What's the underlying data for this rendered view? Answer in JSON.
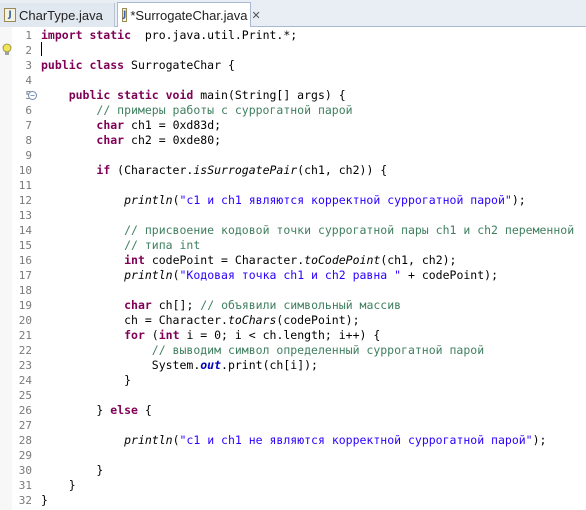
{
  "tabs": [
    {
      "label": "CharType.java",
      "active": false
    },
    {
      "label": "*SurrogateChar.java",
      "active": true
    }
  ],
  "lines": [
    {
      "n": "1",
      "t": [
        [
          "kw",
          "import static"
        ],
        [
          "",
          "  pro.java.util.Print.*;"
        ]
      ]
    },
    {
      "n": "2",
      "t": []
    },
    {
      "n": "3",
      "t": [
        [
          "kw",
          "public class"
        ],
        [
          "",
          " SurrogateChar {"
        ]
      ]
    },
    {
      "n": "4",
      "t": []
    },
    {
      "n": "5",
      "t": [
        [
          "",
          "    "
        ],
        [
          "kw",
          "public static void"
        ],
        [
          "",
          " main(String[] args) {"
        ]
      ]
    },
    {
      "n": "6",
      "t": [
        [
          "",
          "        "
        ],
        [
          "cm",
          "// примеры работы с суррогатной парой"
        ]
      ]
    },
    {
      "n": "7",
      "t": [
        [
          "",
          "        "
        ],
        [
          "kw",
          "char"
        ],
        [
          "",
          " "
        ],
        [
          "vr",
          "ch1"
        ],
        [
          "",
          " = 0xd83d;"
        ]
      ]
    },
    {
      "n": "8",
      "t": [
        [
          "",
          "        "
        ],
        [
          "kw",
          "char"
        ],
        [
          "",
          " "
        ],
        [
          "vr",
          "ch2"
        ],
        [
          "",
          " = 0xde80;"
        ]
      ]
    },
    {
      "n": "9",
      "t": []
    },
    {
      "n": "10",
      "t": [
        [
          "",
          "        "
        ],
        [
          "kw",
          "if"
        ],
        [
          "",
          " (Character."
        ],
        [
          "it",
          "isSurrogatePair"
        ],
        [
          "",
          "(ch1, ch2)) {"
        ]
      ]
    },
    {
      "n": "11",
      "t": []
    },
    {
      "n": "12",
      "t": [
        [
          "",
          "            "
        ],
        [
          "it",
          "println"
        ],
        [
          "",
          "("
        ],
        [
          "st",
          "\"c1 и ch1 являются корректной суррогатной парой\""
        ],
        [
          "",
          ");"
        ]
      ]
    },
    {
      "n": "13",
      "t": []
    },
    {
      "n": "14",
      "t": [
        [
          "",
          "            "
        ],
        [
          "cm",
          "// присвоение кодовой точки суррогатной пары ch1 и ch2 переменной"
        ]
      ]
    },
    {
      "n": "15",
      "t": [
        [
          "",
          "            "
        ],
        [
          "cm",
          "// типа int"
        ]
      ]
    },
    {
      "n": "16",
      "t": [
        [
          "",
          "            "
        ],
        [
          "kw",
          "int"
        ],
        [
          "",
          " "
        ],
        [
          "vr",
          "codePoint"
        ],
        [
          "",
          " = Character."
        ],
        [
          "it",
          "toCodePoint"
        ],
        [
          "",
          "(ch1, ch2);"
        ]
      ]
    },
    {
      "n": "17",
      "t": [
        [
          "",
          "            "
        ],
        [
          "it",
          "println"
        ],
        [
          "",
          "("
        ],
        [
          "st",
          "\"Кодовая точка ch1 и ch2 равна \""
        ],
        [
          "",
          " + codePoint);"
        ]
      ]
    },
    {
      "n": "18",
      "t": []
    },
    {
      "n": "19",
      "t": [
        [
          "",
          "            "
        ],
        [
          "kw",
          "char"
        ],
        [
          "",
          " "
        ],
        [
          "vr",
          "ch"
        ],
        [
          "",
          "[]; "
        ],
        [
          "cm",
          "// объявили символьный массив"
        ]
      ]
    },
    {
      "n": "20",
      "t": [
        [
          "",
          "            ch = Character."
        ],
        [
          "it",
          "toChars"
        ],
        [
          "",
          "(codePoint);"
        ]
      ]
    },
    {
      "n": "21",
      "t": [
        [
          "",
          "            "
        ],
        [
          "kw",
          "for"
        ],
        [
          "",
          " ("
        ],
        [
          "kw",
          "int"
        ],
        [
          "",
          " i = 0; i < ch.length; i++) {"
        ]
      ]
    },
    {
      "n": "22",
      "t": [
        [
          "",
          "                "
        ],
        [
          "cm",
          "// выводим символ определенный суррогатной парой"
        ]
      ]
    },
    {
      "n": "23",
      "t": [
        [
          "",
          "                System."
        ],
        [
          "fdi",
          "out"
        ],
        [
          "",
          ".print(ch[i]);"
        ]
      ]
    },
    {
      "n": "24",
      "t": [
        [
          "",
          "            }"
        ]
      ]
    },
    {
      "n": "25",
      "t": []
    },
    {
      "n": "26",
      "t": [
        [
          "",
          "        } "
        ],
        [
          "kw",
          "else"
        ],
        [
          "",
          " {"
        ]
      ]
    },
    {
      "n": "27",
      "t": []
    },
    {
      "n": "28",
      "t": [
        [
          "",
          "            "
        ],
        [
          "it",
          "println"
        ],
        [
          "",
          "("
        ],
        [
          "st",
          "\"c1 и ch1 не являются корректной суррогатной парой\""
        ],
        [
          "",
          ");"
        ]
      ]
    },
    {
      "n": "29",
      "t": []
    },
    {
      "n": "30",
      "t": [
        [
          "",
          "        }"
        ]
      ]
    },
    {
      "n": "31",
      "t": [
        [
          "",
          "    }"
        ]
      ]
    },
    {
      "n": "32",
      "t": [
        [
          "",
          "}"
        ]
      ]
    }
  ],
  "icons": {
    "tab": "java-file-icon",
    "bulb": "lightbulb-icon",
    "fold": "fold-collapse-icon"
  }
}
